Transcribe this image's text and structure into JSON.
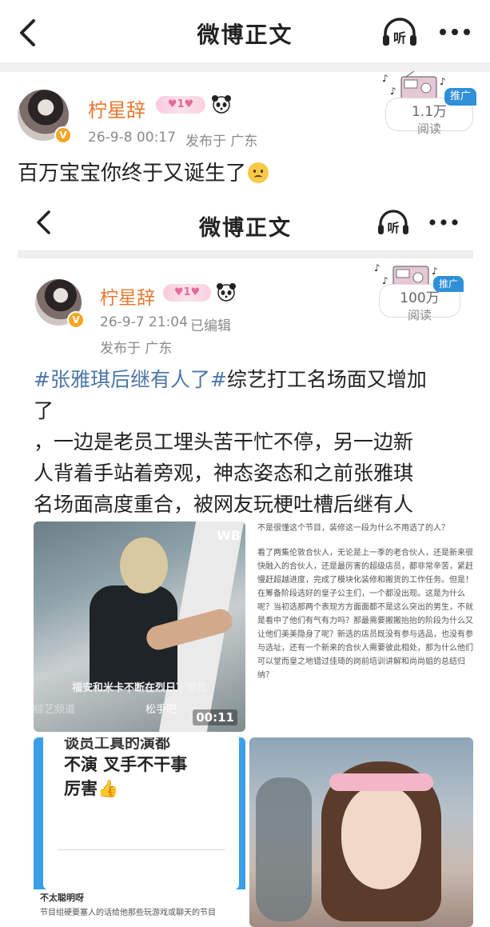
{
  "topbar": {
    "title": "微博正文",
    "listen_label": "听"
  },
  "post": {
    "username": "柠星辞",
    "badge": "♥1♥",
    "time": "26-9-8 00:17",
    "location": "发布于 广东",
    "read_count": "1.1万",
    "read_label": "阅读",
    "promo": "推广",
    "text": "百万宝宝你终于又诞生了"
  },
  "inner": {
    "title": "微博正文",
    "listen_label": "听",
    "username": "柠星辞",
    "badge": "♥1♥",
    "time": "26-9-7 21:04",
    "edited": "已编辑",
    "location": "发布于 广东",
    "read_count": "100万",
    "read_label": "阅读",
    "promo": "推广",
    "hashtag": "#张雅琪后继有人了#",
    "body_line1_rest": "综艺打工名场面又增加",
    "body_line2": "了",
    "body_line3": "，一边是老员工埋头苦干忙不停，另一边新",
    "body_line4": "人背着手站着旁观，神态姿态和之前张雅琪",
    "body_line5": "名场面高度重合，被网友玩梗吐槽后继有人",
    "video": {
      "logo": "WB",
      "subtitle": "福安和米卡不断在烈日下搬货",
      "corner_left": "综艺频道",
      "corner_right": "松手吧",
      "duration": "00:11"
    },
    "doc": {
      "p1": "不是很懂这个节目，装修这一段为什么不用选了的人？",
      "p2": "看了两集伦敦合伙人，无论是上一季的老合伙人，还是新来很快融入的合伙人，还是最厉害的超级店员，都非常辛苦，紧赶慢赶超越进度，完成了模块化装修和搬货的工作任务。但是！在筹备阶段选好的皇子公主们，一个都没出现。这是为什么呢？当初选那两个表现方方面面都不是这么突出的男生，不就是看中了他们有气有力吗？那最需要搬搬抬抬的阶段为什么又让他们美美隐身了呢？新选的店员既没有参与选品，也没有参与选址，还有一个新来的合伙人需要彼此相处，那为什么他们可以堂而皇之地错过佳琦的岗前培训讲解和尚尚姐的总结归纳？"
    },
    "chat": {
      "line1": "谈员工真的演都",
      "line2": "不演 叉手不干事",
      "line3": "厉害👍",
      "bottom_title": "不太聪明呀",
      "bottom_text": "节目组硬要塞人的话给他那些玩游戏或聊天的节目"
    }
  },
  "colors": {
    "accent_orange": "#e8772e",
    "hashtag_blue": "#4c77a8",
    "promo_blue": "#2f8fd8",
    "verify_gold": "#f5a623"
  }
}
